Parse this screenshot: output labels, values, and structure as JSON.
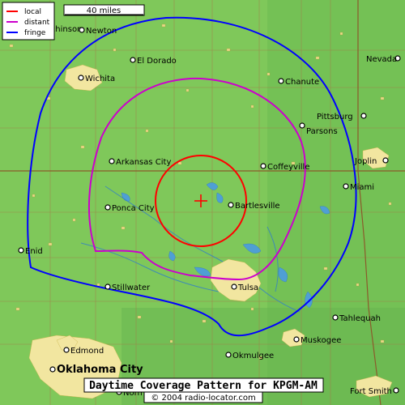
{
  "legend": {
    "items": [
      {
        "label": "local",
        "color": "#ff0000"
      },
      {
        "label": "distant",
        "color": "#cc00cc"
      },
      {
        "label": "fringe",
        "color": "#0000ff"
      }
    ]
  },
  "scale": {
    "label": "40 miles"
  },
  "footer": {
    "title": "Daytime Coverage Pattern for KPGM-AM",
    "copyright": "© 2004 radio-locator.com"
  },
  "colors": {
    "land": "#7fc85a",
    "grid": "#9b6a3a",
    "urban": "#f2e6a0",
    "water": "#5aa6d6",
    "local": "#ff0000",
    "distant": "#cc00cc",
    "fringe": "#0000ff",
    "transmitter": "#ff0000"
  },
  "cities": [
    {
      "name": "Hutchinson",
      "marker": "dot",
      "big": false
    },
    {
      "name": "Newton",
      "marker": "dot",
      "big": false
    },
    {
      "name": "El Dorado",
      "marker": "dot",
      "big": false
    },
    {
      "name": "Wichita",
      "marker": "dot",
      "big": false
    },
    {
      "name": "Chanute",
      "marker": "dot",
      "big": false
    },
    {
      "name": "Nevada",
      "marker": "dot",
      "big": false
    },
    {
      "name": "Pittsburg",
      "marker": "dot",
      "big": false
    },
    {
      "name": "Parsons",
      "marker": "dot",
      "big": false
    },
    {
      "name": "Joplin",
      "marker": "dot",
      "big": false
    },
    {
      "name": "Arkansas City",
      "marker": "dot",
      "big": false
    },
    {
      "name": "Coffeyville",
      "marker": "dot",
      "big": false
    },
    {
      "name": "Miami",
      "marker": "dot",
      "big": false
    },
    {
      "name": "Ponca City",
      "marker": "dot",
      "big": false
    },
    {
      "name": "Bartlesville",
      "marker": "dot",
      "big": false
    },
    {
      "name": "Enid",
      "marker": "dot",
      "big": false
    },
    {
      "name": "Stillwater",
      "marker": "dot",
      "big": false
    },
    {
      "name": "Tulsa",
      "marker": "dot",
      "big": false
    },
    {
      "name": "Tahlequah",
      "marker": "dot",
      "big": false
    },
    {
      "name": "Muskogee",
      "marker": "dot",
      "big": false
    },
    {
      "name": "Edmond",
      "marker": "dot",
      "big": false
    },
    {
      "name": "Okmulgee",
      "marker": "dot",
      "big": false
    },
    {
      "name": "Oklahoma City",
      "marker": "dot",
      "big": true
    },
    {
      "name": "Norman",
      "marker": "dot",
      "big": false
    },
    {
      "name": "Fort Smith",
      "marker": "dot",
      "big": false
    }
  ]
}
